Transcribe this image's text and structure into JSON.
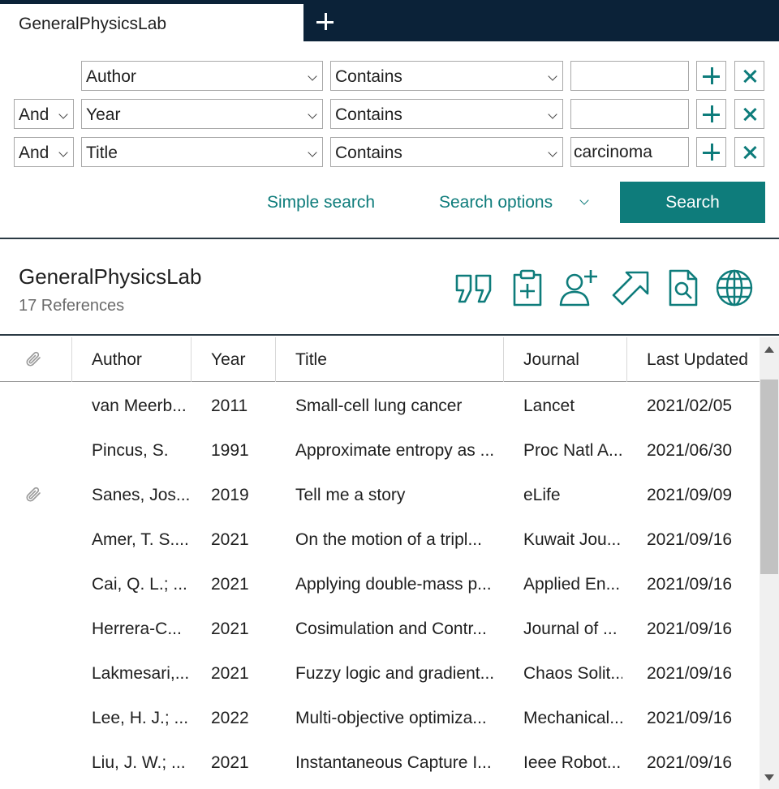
{
  "tabs": {
    "active_label": "GeneralPhysicsLab",
    "add_icon": "plus-icon"
  },
  "search": {
    "rows": [
      {
        "connector": "",
        "field": "Author",
        "operator": "Contains",
        "value": ""
      },
      {
        "connector": "And",
        "field": "Year",
        "operator": "Contains",
        "value": ""
      },
      {
        "connector": "And",
        "field": "Title",
        "operator": "Contains",
        "value": "carcinoma"
      }
    ],
    "simple_search_label": "Simple search",
    "options_label": "Search options",
    "search_button_label": "Search"
  },
  "library": {
    "title": "GeneralPhysicsLab",
    "count_text": "17 References",
    "tools": [
      "quote-icon",
      "clipboard-add-icon",
      "add-user-icon",
      "share-arrow-icon",
      "find-document-icon",
      "globe-icon"
    ]
  },
  "table": {
    "headers": {
      "attachment": "paperclip-icon",
      "author": "Author",
      "year": "Year",
      "title": "Title",
      "journal": "Journal",
      "updated": "Last Updated"
    },
    "rows": [
      {
        "attach": false,
        "author": "van Meerb...",
        "year": "2011",
        "title": "Small-cell lung cancer",
        "journal": "Lancet",
        "updated": "2021/02/05"
      },
      {
        "attach": false,
        "author": "Pincus, S.",
        "year": "1991",
        "title": "Approximate entropy as ...",
        "journal": "Proc Natl A...",
        "updated": "2021/06/30"
      },
      {
        "attach": true,
        "author": "Sanes, Jos...",
        "year": "2019",
        "title": "Tell me a story",
        "journal": "eLife",
        "updated": "2021/09/09"
      },
      {
        "attach": false,
        "author": "Amer, T. S....",
        "year": "2021",
        "title": "On the motion of a tripl...",
        "journal": "Kuwait Jou...",
        "updated": "2021/09/16"
      },
      {
        "attach": false,
        "author": "Cai, Q. L.; ...",
        "year": "2021",
        "title": "Applying double-mass p...",
        "journal": "Applied En...",
        "updated": "2021/09/16"
      },
      {
        "attach": false,
        "author": "Herrera-C...",
        "year": "2021",
        "title": "Cosimulation and Contr...",
        "journal": "Journal of ...",
        "updated": "2021/09/16"
      },
      {
        "attach": false,
        "author": "Lakmesari,...",
        "year": "2021",
        "title": "Fuzzy logic and gradient...",
        "journal": "Chaos Solit...",
        "updated": "2021/09/16"
      },
      {
        "attach": false,
        "author": "Lee, H. J.; ...",
        "year": "2022",
        "title": "Multi-objective optimiza...",
        "journal": "Mechanical...",
        "updated": "2021/09/16"
      },
      {
        "attach": false,
        "author": "Liu, J. W.; ...",
        "year": "2021",
        "title": "Instantaneous Capture I...",
        "journal": "Ieee Robot...",
        "updated": "2021/09/16"
      }
    ]
  },
  "colors": {
    "accent": "#0e7c7b",
    "tabbar": "#0b2238"
  }
}
